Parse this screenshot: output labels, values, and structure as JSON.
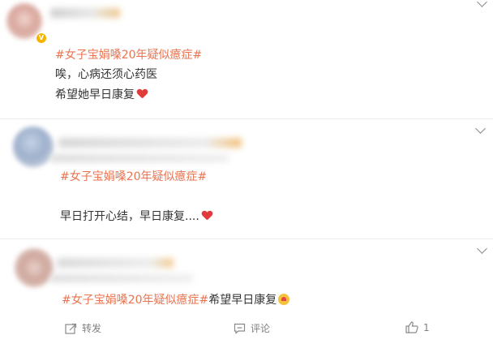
{
  "comments": [
    {
      "topic": "#女子宝娟嗓20年疑似癔症#",
      "lines": [
        "唉，心病还须心药医",
        "希望她早日康复"
      ]
    },
    {
      "topic": "#女子宝娟嗓20年疑似癔症#",
      "lines": [
        "早日打开心结，早日康复...."
      ]
    },
    {
      "topic": "#女子宝娟嗓20年疑似癔症#",
      "text": "希望早日康复"
    }
  ],
  "actions": {
    "repost_label": "转发",
    "comment_label": "评论",
    "like_count": "1"
  },
  "icons": [
    "chevron-down-icon",
    "heart-emoji-icon",
    "verified-badge-icon",
    "repost-icon",
    "comment-icon",
    "like-icon"
  ],
  "colors": {
    "topic": "#eb7350",
    "text": "#333333",
    "heart": "#e23a3a",
    "action": "#808080"
  }
}
